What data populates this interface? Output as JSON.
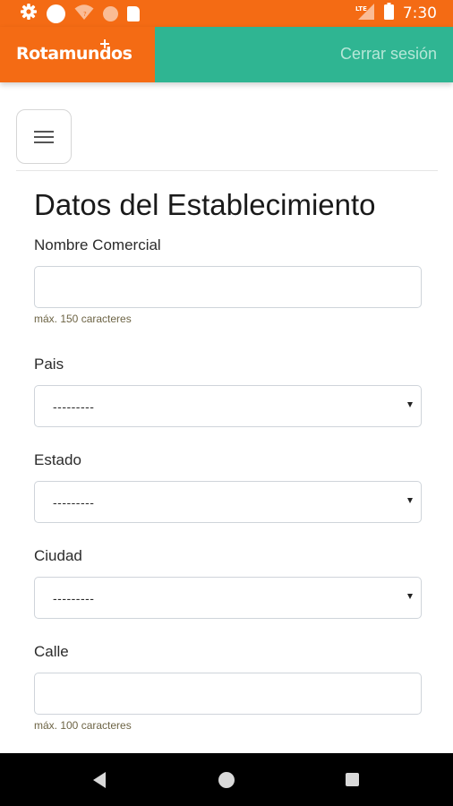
{
  "status_bar": {
    "time": "7:30",
    "network": "LTE",
    "icons": [
      "gear-icon",
      "circle-icon",
      "wifi-question-icon",
      "circle-icon",
      "sd-card-icon",
      "lte-signal-icon",
      "battery-icon"
    ]
  },
  "header": {
    "brand": "Rotamundos",
    "logout_label": "Cerrar sesión"
  },
  "colors": {
    "brand_orange": "#f46b14",
    "header_teal": "#2fb592",
    "logout_text": "#b6e7d8",
    "help_text": "#6d6445"
  },
  "menu": {
    "icon": "hamburger-icon"
  },
  "form": {
    "title": "Datos del Establecimiento",
    "nombre_comercial": {
      "label": "Nombre Comercial",
      "value": "",
      "help": "máx. 150 caracteres"
    },
    "pais": {
      "label": "Pais",
      "selected": "---------"
    },
    "estado": {
      "label": "Estado",
      "selected": "---------"
    },
    "ciudad": {
      "label": "Ciudad",
      "selected": "---------"
    },
    "calle": {
      "label": "Calle",
      "value": "",
      "help": "máx. 100 caracteres"
    }
  },
  "nav_bar": {
    "buttons": [
      "back-icon",
      "home-icon",
      "recents-icon"
    ]
  }
}
